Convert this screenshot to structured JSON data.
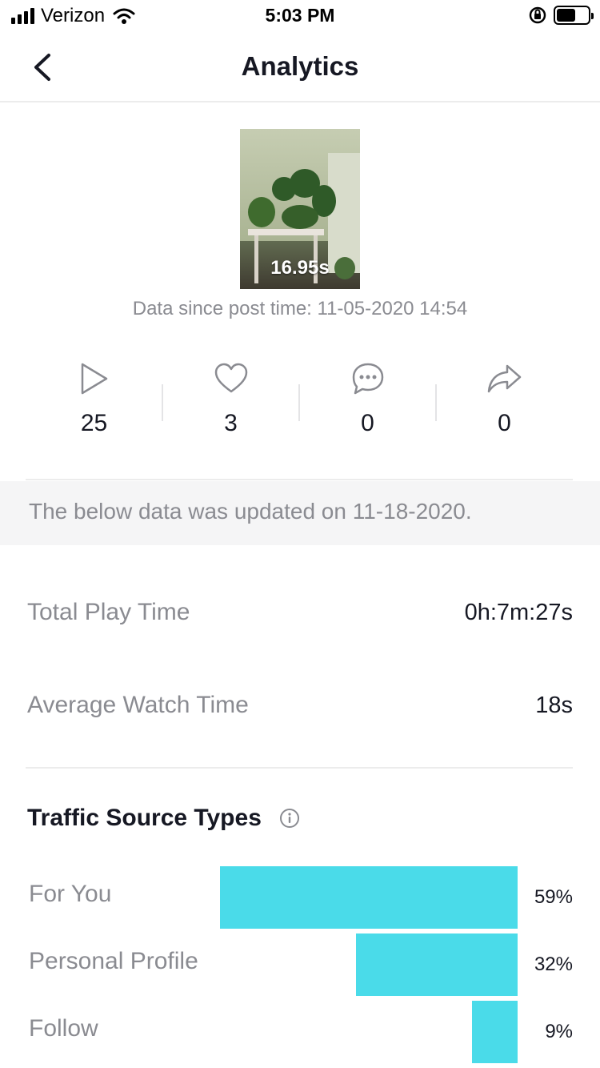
{
  "status_bar": {
    "carrier": "Verizon",
    "time": "5:03 PM",
    "battery_level": 0.6
  },
  "nav": {
    "title": "Analytics",
    "back_icon": "chevron-left-icon"
  },
  "video": {
    "duration": "16.95s",
    "data_since": "Data since post time: 11-05-2020 14:54"
  },
  "stats": [
    {
      "icon": "play-icon",
      "value": "25"
    },
    {
      "icon": "heart-icon",
      "value": "3"
    },
    {
      "icon": "comment-icon",
      "value": "0"
    },
    {
      "icon": "share-icon",
      "value": "0"
    }
  ],
  "update_notice": "The below data was updated on 11-18-2020.",
  "metrics": {
    "total_play_time": {
      "label": "Total Play Time",
      "value": "0h:7m:27s"
    },
    "average_watch_time": {
      "label": "Average Watch Time",
      "value": "18s"
    }
  },
  "traffic": {
    "title": "Traffic Source Types",
    "info_icon": "info-icon",
    "bar_color": "#4adbe9",
    "items": [
      {
        "label": "For You",
        "pct_text": "59%",
        "pct": 59
      },
      {
        "label": "Personal Profile",
        "pct_text": "32%",
        "pct": 32
      },
      {
        "label": "Follow",
        "pct_text": "9%",
        "pct": 9
      }
    ]
  }
}
